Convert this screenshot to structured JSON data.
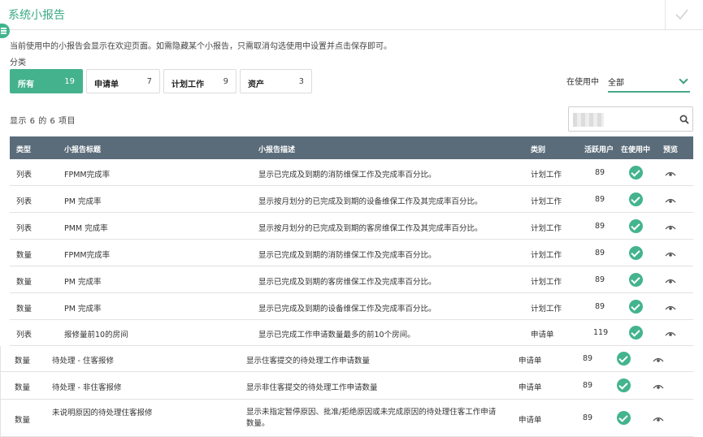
{
  "header": {
    "title": "系统小报告"
  },
  "intro_text": "当前使用中的小报告会显示在欢迎页面。如需隐藏某个小报告，只需取消勾选使用中设置并点击保存即可。",
  "category_label": "分类",
  "categories": [
    {
      "label": "所有",
      "count": "19"
    },
    {
      "label": "申请单",
      "count": "7"
    },
    {
      "label": "计划工作",
      "count": "9"
    },
    {
      "label": "资产",
      "count": "3"
    }
  ],
  "in_use_filter": {
    "label": "在使用中",
    "value": "全部"
  },
  "results_text": "显示 6 的 6 项目",
  "search": {
    "placeholder": ""
  },
  "table": {
    "headers": [
      "类型",
      "小报告标题",
      "小报告描述",
      "类别",
      "活跃用户",
      "在使用中",
      "预览"
    ],
    "rows": [
      {
        "type": "列表",
        "title": "FPMM完成率",
        "desc": "显示已完成及到期的消防维保工作及完成率百分比。",
        "category": "计划工作",
        "users": "89"
      },
      {
        "type": "列表",
        "title": "PM 完成率",
        "desc": "显示按月划分的已完成及到期的设备维保工作及其完成率百分比。",
        "category": "计划工作",
        "users": "89"
      },
      {
        "type": "列表",
        "title": "PMM 完成率",
        "desc": "显示按月划分的已完成及到期的客房维保工作及其完成率百分比。",
        "category": "计划工作",
        "users": "89"
      },
      {
        "type": "数量",
        "title": "FPMM完成率",
        "desc": "显示已完成及到期的消防维保工作及完成率百分比。",
        "category": "计划工作",
        "users": "89"
      },
      {
        "type": "数量",
        "title": "PM 完成率",
        "desc": "显示已完成及到期的客房维保工作及完成率百分比。",
        "category": "计划工作",
        "users": "89"
      },
      {
        "type": "数量",
        "title": "PM 完成率",
        "desc": "显示已完成及到期的设备维保工作及完成率百分比。",
        "category": "计划工作",
        "users": "89"
      },
      {
        "type": "列表",
        "title": "报修量前10的房间",
        "desc": "显示已完成工作申请数量最多的前10个房间。",
        "category": "申请单",
        "users": "119"
      },
      {
        "type": "数量",
        "title": "待处理 - 住客报修",
        "desc": "显示住客提交的待处理工作申请数量",
        "category": "申请单",
        "users": "89"
      },
      {
        "type": "数量",
        "title": "待处理 - 非住客报修",
        "desc": "显示非住客提交的待处理工作申请数量",
        "category": "申请单",
        "users": "89"
      },
      {
        "type": "数量",
        "title": "未说明原因的待处理住客报修",
        "desc": "显示未指定暂停原因、批准/拒绝原因或未完成原因的待处理住客工作申请",
        "desc2": "数量。",
        "category": "申请单",
        "users": "89"
      }
    ]
  },
  "colors": {
    "accent": "#43b48e",
    "header_bg": "#5a6c7a"
  },
  "icons": {
    "confirm": "check-icon",
    "search": "search-icon",
    "in_use": "check-circle-icon",
    "preview": "eye-icon",
    "menu": "menu-icon"
  }
}
